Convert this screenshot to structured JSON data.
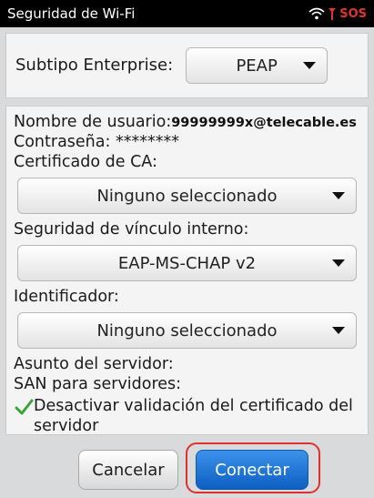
{
  "statusbar": {
    "title": "Seguridad de Wi-Fi",
    "sos": "SOS"
  },
  "enterprise": {
    "label": "Subtipo Enterprise:",
    "value": "PEAP"
  },
  "form": {
    "username_label": "Nombre de usuario:",
    "username_value": "99999999x@telecable.es",
    "password_label": "Contraseña: ********",
    "ca_cert_label": "Certificado de CA:",
    "ca_cert_value": "Ninguno seleccionado",
    "inner_security_label": "Seguridad de vínculo interno:",
    "inner_security_value": "EAP-MS-CHAP v2",
    "identifier_label": "Identificador:",
    "identifier_value": "Ninguno seleccionado",
    "server_subject_label": "Asunto del servidor:",
    "san_label": "SAN para servidores:",
    "disable_validation_label": "Desactivar validación del certificado del servidor",
    "disable_validation_checked": true
  },
  "buttons": {
    "cancel": "Cancelar",
    "connect": "Conectar"
  },
  "colors": {
    "accent_blue": "#0d5fc1",
    "highlight_red": "#e0302d",
    "check_green": "#3aa33a"
  }
}
